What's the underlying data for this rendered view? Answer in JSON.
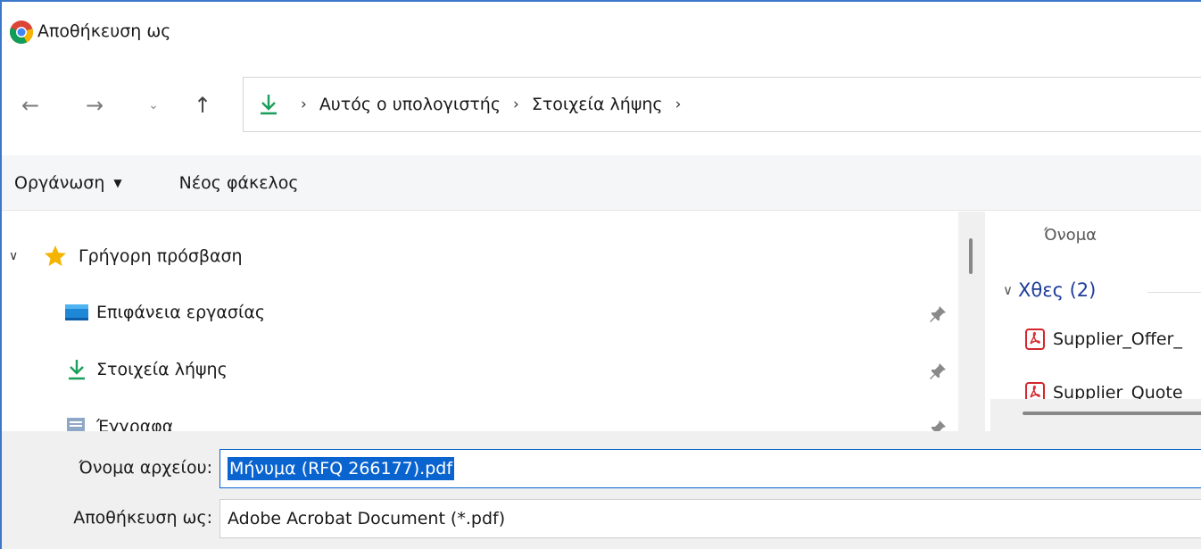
{
  "window": {
    "title": "Αποθήκευση ως"
  },
  "nav": {
    "breadcrumb": [
      "Αυτός ο υπολογιστής",
      "Στοιχεία λήψης"
    ]
  },
  "toolbar": {
    "organize_label": "Οργάνωση",
    "new_folder_label": "Νέος φάκελος"
  },
  "navpane": {
    "quick_access_label": "Γρήγορη πρόσβαση",
    "items": [
      {
        "label": "Επιφάνεια εργασίας",
        "icon": "desktop-icon"
      },
      {
        "label": "Στοιχεία λήψης",
        "icon": "download-icon"
      },
      {
        "label": "Έγγραφα",
        "icon": "documents-icon"
      }
    ]
  },
  "filelist": {
    "column_name": "Όνομα",
    "group_label": "Χθες (2)",
    "files": [
      {
        "name": "Supplier_Offer_",
        "icon": "pdf-icon"
      },
      {
        "name": "Supplier_Quote",
        "icon": "pdf-icon"
      }
    ]
  },
  "fields": {
    "filename_label": "Όνομα αρχείου:",
    "filename_value": "Μήνυμα (RFQ 266177).pdf",
    "saveas_label": "Αποθήκευση ως:",
    "saveas_value": "Adobe Acrobat Document (*.pdf)"
  },
  "colors": {
    "accent": "#0a64d0",
    "group_header": "#1f3d99",
    "download_green": "#1a9e5c",
    "pdf_red": "#d4262c",
    "star": "#f4b400"
  }
}
